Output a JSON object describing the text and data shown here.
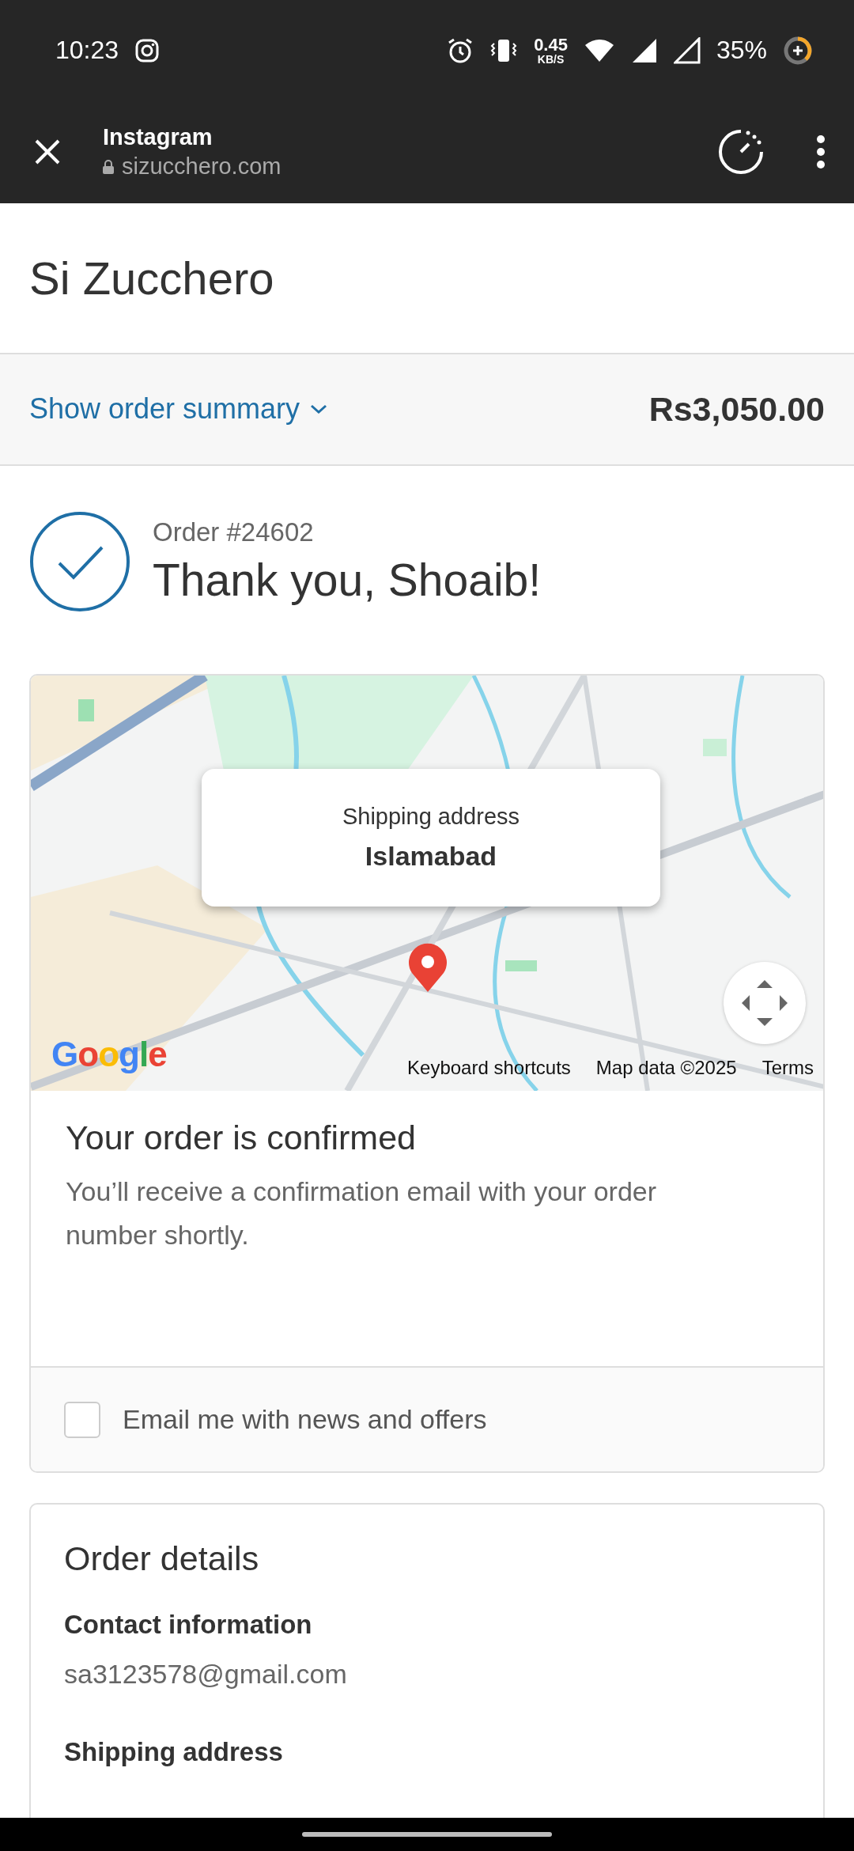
{
  "status_bar": {
    "time": "10:23",
    "speed_value": "0.45",
    "speed_unit": "KB/S",
    "battery": "35%"
  },
  "browser": {
    "title": "Instagram",
    "url": "sizucchero.com",
    "secure": true
  },
  "shop": {
    "name": "Si Zucchero"
  },
  "summary": {
    "toggle": "Show order summary",
    "total": "Rs3,050.00",
    "expanded": false
  },
  "order": {
    "number": "Order #24602",
    "greeting": "Thank you, Shoaib!"
  },
  "map": {
    "popup_label": "Shipping address",
    "popup_city": "Islamabad",
    "logo": "Google",
    "links": [
      "Keyboard shortcuts",
      "Map data ©2025",
      "Terms"
    ]
  },
  "confirmation": {
    "title": "Your order is confirmed",
    "text": "You’ll receive a confirmation email with your order number shortly.",
    "newsletter": {
      "label": "Email me with news and offers",
      "checked": false
    }
  },
  "details": {
    "title": "Order details",
    "sections": [
      {
        "heading": "Contact information",
        "value": "sa3123578@gmail.com"
      },
      {
        "heading": "Shipping address"
      }
    ]
  }
}
